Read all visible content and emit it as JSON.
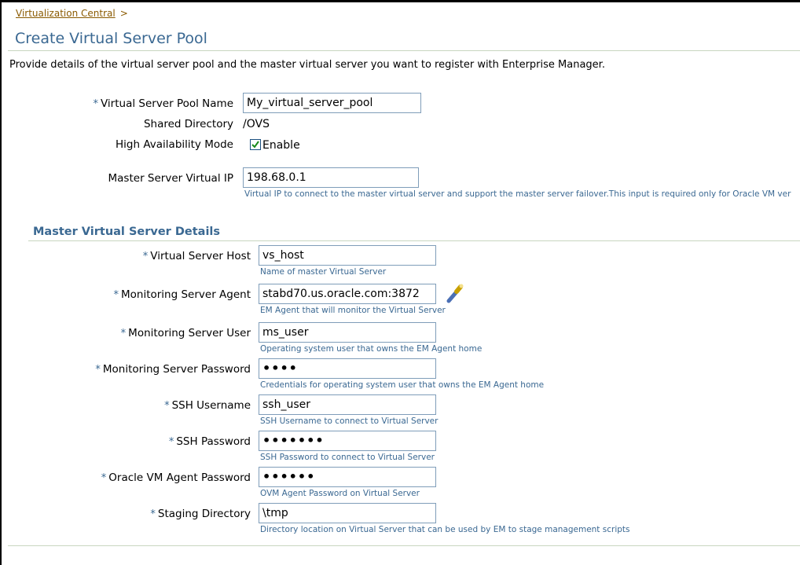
{
  "breadcrumb": {
    "link": "Virtualization Central",
    "separator": ">"
  },
  "page": {
    "title": "Create Virtual Server Pool",
    "intro": "Provide details of the virtual server pool and the master virtual server you want to register with Enterprise Manager."
  },
  "pool": {
    "name": {
      "label": "Virtual Server Pool Name",
      "value": "My_virtual_server_pool"
    },
    "shared_dir": {
      "label": "Shared Directory",
      "value": "/OVS"
    },
    "ha_mode": {
      "label": "High Availability Mode",
      "checkbox_label": "Enable",
      "checked": true
    },
    "master_vip": {
      "label": "Master Server Virtual IP",
      "value": "198.68.0.1",
      "hint": "Virtual IP to connect to the master virtual server and support the master server failover.This input is required only for Oracle VM ver"
    }
  },
  "master": {
    "heading": "Master Virtual Server Details",
    "host": {
      "label": "Virtual Server Host",
      "value": "vs_host",
      "hint": "Name of master Virtual Server"
    },
    "agent": {
      "label": "Monitoring Server Agent",
      "value": "stabd70.us.oracle.com:3872",
      "hint": "EM Agent that will monitor the Virtual Server",
      "search_icon": "flashlight-icon"
    },
    "user": {
      "label": "Monitoring Server User",
      "value": "ms_user",
      "hint": "Operating system user that owns the EM Agent home"
    },
    "password": {
      "label": "Monitoring Server Password",
      "value": "••••",
      "hint": "Credentials for operating system user that owns the EM Agent home"
    },
    "ssh_user": {
      "label": "SSH Username",
      "value": "ssh_user",
      "hint": "SSH Username to connect to Virtual Server"
    },
    "ssh_password": {
      "label": "SSH Password",
      "value": "•••••••",
      "hint": "SSH Password to connect to Virtual Server"
    },
    "ovm_password": {
      "label": "Oracle VM Agent Password",
      "value": "••••••",
      "hint": "OVM Agent Password on Virtual Server"
    },
    "staging_dir": {
      "label": "Staging Directory",
      "value": "\\tmp",
      "hint": "Directory location on Virtual Server that can be used by EM to stage management scripts"
    }
  },
  "required_marker": "*",
  "colors": {
    "accent": "#3a6892",
    "link": "#8a5a00",
    "rule": "#c8d6c0"
  }
}
